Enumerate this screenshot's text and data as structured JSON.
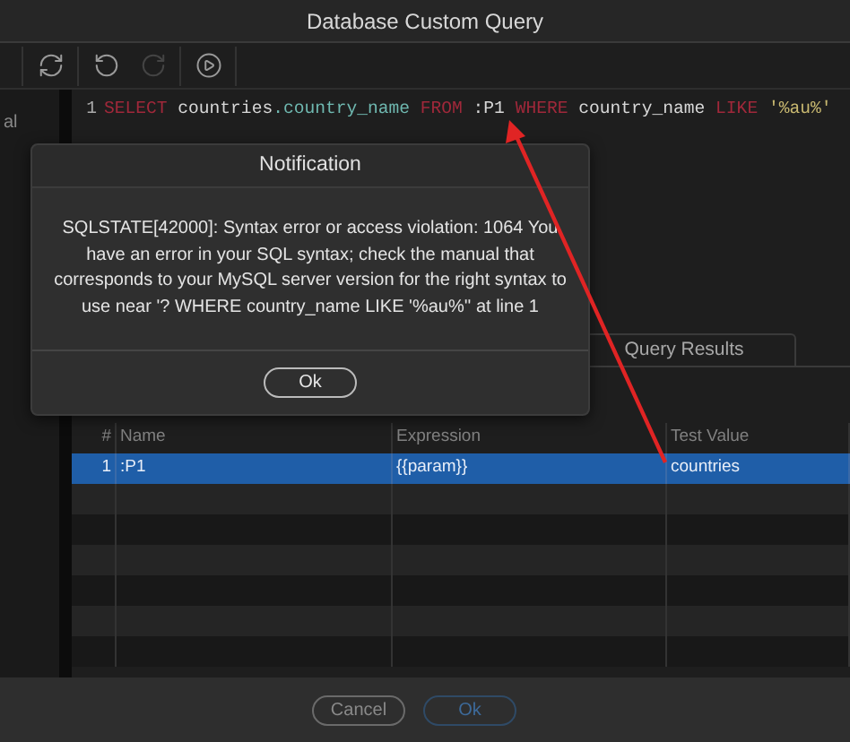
{
  "window": {
    "title": "Database Custom Query"
  },
  "toolbar": [
    {
      "kind": "refresh",
      "disabled": false
    },
    {
      "kind": "undo",
      "disabled": false
    },
    {
      "kind": "redo",
      "disabled": true
    },
    {
      "kind": "run",
      "disabled": false
    }
  ],
  "sidebar": {
    "text": "al"
  },
  "editor": {
    "line_number": "1",
    "tokens": [
      {
        "text": "SELECT",
        "kind": "keyword"
      },
      {
        "text": " countries",
        "kind": "plain"
      },
      {
        "text": ".country_name",
        "kind": "field"
      },
      {
        "text": " FROM",
        "kind": "keyword"
      },
      {
        "text": " :P1",
        "kind": "plain"
      },
      {
        "text": " WHERE",
        "kind": "keyword"
      },
      {
        "text": " country_name",
        "kind": "plain"
      },
      {
        "text": " LIKE",
        "kind": "keyword"
      },
      {
        "text": " '%au%'",
        "kind": "string"
      }
    ]
  },
  "tabs": [
    {
      "label": "Query Results",
      "selected": false
    }
  ],
  "table": {
    "columns": [
      "#",
      "Name",
      "Expression",
      "Test Value"
    ],
    "rows": [
      {
        "cells": [
          "1",
          ":P1",
          "{{param}}",
          "countries"
        ],
        "selected": true
      }
    ]
  },
  "dialog": {
    "title": "Notification",
    "message": "SQLSTATE[42000]: Syntax error or access violation: 1064 You have an error in your SQL syntax; check the manual that corresponds to your MySQL server version for the right syntax to use near '? WHERE country_name LIKE '%au%'' at line 1",
    "button": "Ok"
  },
  "footer": {
    "buttons": [
      {
        "label": "Cancel",
        "primary": false
      },
      {
        "label": "Ok",
        "primary": true
      }
    ]
  }
}
